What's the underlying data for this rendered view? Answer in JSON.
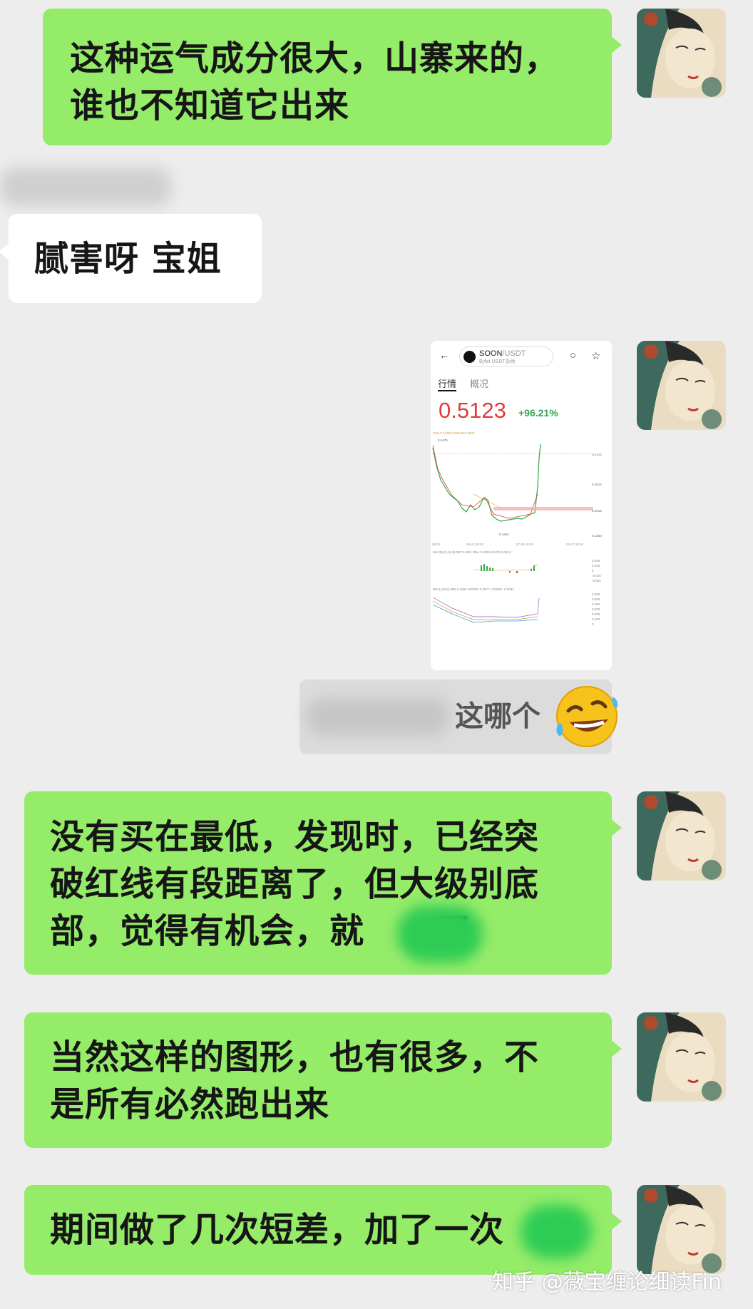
{
  "messages": {
    "m1": {
      "line1": "这种运气成分很大，山寨来的，",
      "line2": "谁也不知道它出来"
    },
    "m2": {
      "text": "腻害呀 宝姐"
    },
    "m3": {
      "quote_text": "这哪个"
    },
    "m4": {
      "line1": "没有买在最低，发现时，已经突",
      "line2": "破红线有段距离了，但大级别底",
      "line3": "部，觉得有机会，就",
      "line3_tail": "了"
    },
    "m5": {
      "line1": "当然这样的图形，也有很多，不",
      "line2": "是所有必然跑出来"
    },
    "m6": {
      "text": "期间做了几次短差，加了一次"
    }
  },
  "screenshot": {
    "back_icon": "←",
    "symbol": "SOON",
    "pair_suffix": "/USDT",
    "sub_label": "Bybit USDT永续",
    "tabs": [
      "行情",
      "概况"
    ],
    "price": "0.5123",
    "change": "+96.21%",
    "search_icon": "○",
    "star_icon": "☆",
    "indicator_row1": "EMA7 0.5081 EMA25 0.3005",
    "indicator_row2": "MACD(12,26,9) DIF 0.0491 DEA 0.0285 MACD 0.0412",
    "indicator_row3": "BOLL(20,2) MID 0.1894 UPPER 0.3877 LOWER -0.0084",
    "top_label": "0.5475",
    "y_labels": [
      "0.5124",
      "0.3012",
      "0.2018",
      "0.1353"
    ],
    "low_label": "0.1264",
    "x_labels": [
      "08:00",
      "06-23 08:00",
      "07-26 08:00",
      "08-27 08:00"
    ],
    "macd_labels": [
      "0.050",
      "0.025",
      "0",
      "-0.025",
      "-0.050"
    ],
    "boll_labels": [
      "0.600",
      "0.500",
      "0.400",
      "0.300",
      "0.200",
      "0.100",
      "0"
    ],
    "colors": {
      "up": "#2fa84f",
      "down": "#e03b3b"
    }
  },
  "colors": {
    "bubble_green": "#95ec69",
    "bubble_white": "#ffffff",
    "background": "#ededed"
  },
  "watermark": "知乎 @薇宝缠论细读Fin"
}
